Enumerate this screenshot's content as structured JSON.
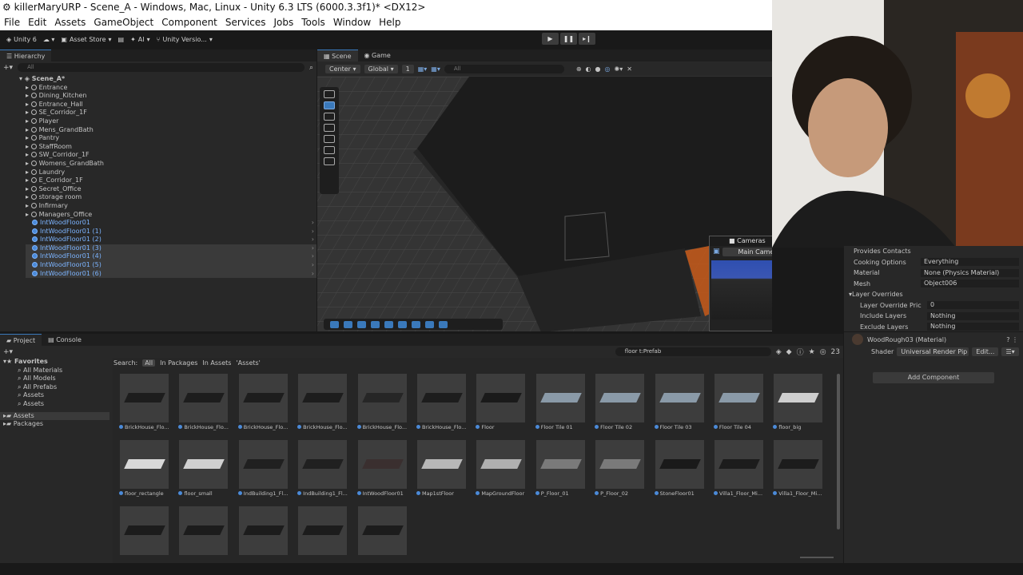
{
  "window": {
    "title": "killerMaryURP - Scene_A - Windows, Mac, Linux - Unity 6.3 LTS (6000.3.3f1)* <DX12>"
  },
  "menu": [
    "File",
    "Edit",
    "Assets",
    "GameObject",
    "Component",
    "Services",
    "Jobs",
    "Tools",
    "Window",
    "Help"
  ],
  "toolbar": {
    "account": "Unity 6",
    "asset_store": "Asset Store",
    "ai": "AI",
    "version_control": "Unity Versio..."
  },
  "hierarchy": {
    "tab": "Hierarchy",
    "search_placeholder": "All",
    "scene": "Scene_A*",
    "items": [
      "Entrance",
      "Dining_Kitchen",
      "Entrance_Hall",
      "SE_Corridor_1F",
      "Player",
      "Mens_GrandBath",
      "Pantry",
      "StaffRoom",
      "SW_Corridor_1F",
      "Womens_GrandBath",
      "Laundry",
      "E_Corridor_1F",
      "Secret_Office",
      "storage room",
      "Infirmary",
      "Managers_Office"
    ],
    "prefabs": [
      "IntWoodFloor01",
      "IntWoodFloor01 (1)",
      "IntWoodFloor01 (2)",
      "IntWoodFloor01 (3)",
      "IntWoodFloor01 (4)",
      "IntWoodFloor01 (5)",
      "IntWoodFloor01 (6)"
    ]
  },
  "scene": {
    "tabs": [
      "Scene",
      "Game"
    ],
    "pivot": "Center",
    "space": "Global",
    "grid_value": "1",
    "search_placeholder": "All",
    "cameras_title": "Cameras",
    "camera_selected": "Main Camera"
  },
  "inspector": {
    "rows": [
      {
        "label": "Provides Contacts",
        "value": ""
      },
      {
        "label": "Cooking Options",
        "value": "Everything"
      },
      {
        "label": "Material",
        "value": "None (Physics Material)"
      },
      {
        "label": "Mesh",
        "value": "Object006"
      }
    ],
    "layer_overrides": "Layer Overrides",
    "layer_rows": [
      {
        "label": "Layer Override Pric",
        "value": "0"
      },
      {
        "label": "Include Layers",
        "value": "Nothing"
      },
      {
        "label": "Exclude Layers",
        "value": "Nothing"
      }
    ],
    "material_name": "WoodRough03 (Material)",
    "shader_label": "Shader",
    "shader_value": "Universal Render Pip",
    "edit_label": "Edit...",
    "add_component": "Add Component"
  },
  "project": {
    "tabs": [
      "Project",
      "Console"
    ],
    "search_value": "floor t:Prefab",
    "count": "23",
    "favorites_title": "Favorites",
    "favorites": [
      "All Materials",
      "All Models",
      "All Prefabs",
      "Assets",
      "Assets"
    ],
    "roots": [
      "Assets",
      "Packages"
    ],
    "search_label": "Search:",
    "scopes": [
      "All",
      "In Packages",
      "In Assets",
      "'Assets'"
    ],
    "assets": [
      {
        "name": "BrickHouse_Flo...",
        "color": "#1d1d1d"
      },
      {
        "name": "BrickHouse_Flo...",
        "color": "#1d1d1d"
      },
      {
        "name": "BrickHouse_Flo...",
        "color": "#1d1d1d"
      },
      {
        "name": "BrickHouse_Flo...",
        "color": "#1d1d1d"
      },
      {
        "name": "BrickHouse_Flo...",
        "color": "#262626"
      },
      {
        "name": "BrickHouse_Flo...",
        "color": "#1d1d1d"
      },
      {
        "name": "Floor",
        "color": "#1a1a1a"
      },
      {
        "name": "Floor Tile 01",
        "color": "#8a9aa8"
      },
      {
        "name": "Floor Tile 02",
        "color": "#8a9aa8"
      },
      {
        "name": "Floor Tile 03",
        "color": "#8a9aa8"
      },
      {
        "name": "Floor Tile 04",
        "color": "#8a9aa8"
      },
      {
        "name": "floor_big",
        "color": "#cfcfcf"
      },
      {
        "name": "floor_rectangle",
        "color": "#d8d8d8"
      },
      {
        "name": "floor_small",
        "color": "#d0d0d0"
      },
      {
        "name": "IndBuilding1_Fl...",
        "color": "#202020"
      },
      {
        "name": "IndBuilding1_Fl...",
        "color": "#202020"
      },
      {
        "name": "IntWoodFloor01",
        "color": "#3a2f2f"
      },
      {
        "name": "Map1stFloor",
        "color": "#b8b8b8"
      },
      {
        "name": "MapGroundFloor",
        "color": "#b0b0b0"
      },
      {
        "name": "P_Floor_01",
        "color": "#7a7a7a"
      },
      {
        "name": "P_Floor_02",
        "color": "#7a7a7a"
      },
      {
        "name": "StoneFloor01",
        "color": "#1a1a1a"
      },
      {
        "name": "Villa1_Floor_Mi...",
        "color": "#1c1c1c"
      },
      {
        "name": "Villa1_Floor_Mi...",
        "color": "#1c1c1c"
      },
      {
        "name": "",
        "color": "#1c1c1c"
      },
      {
        "name": "",
        "color": "#1c1c1c"
      },
      {
        "name": "",
        "color": "#1c1c1c"
      },
      {
        "name": "",
        "color": "#1c1c1c"
      },
      {
        "name": "",
        "color": "#1c1c1c"
      }
    ]
  }
}
